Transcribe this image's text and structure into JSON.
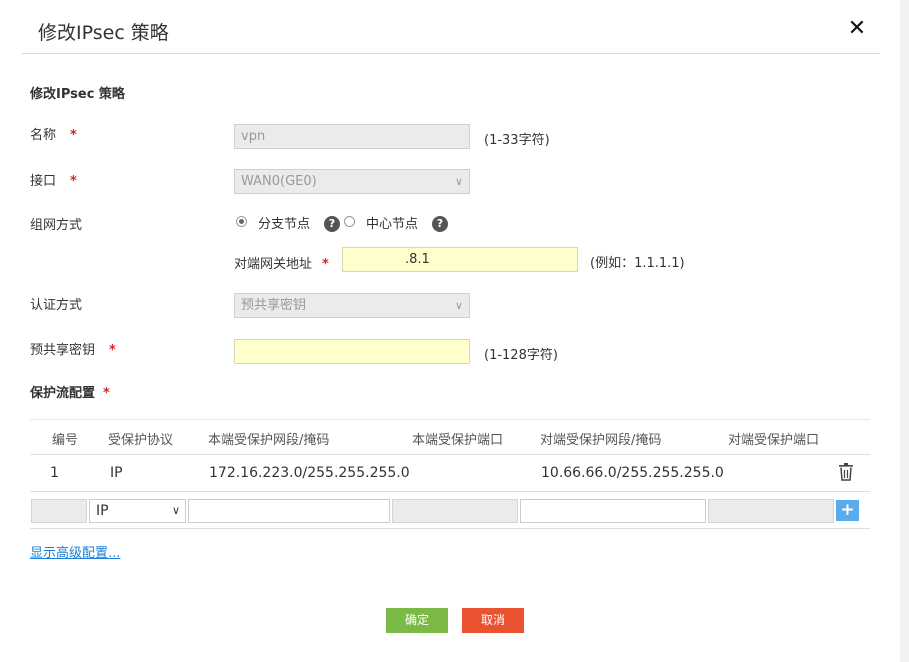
{
  "dialog": {
    "title": "修改IPsec 策略",
    "close_label": "✕"
  },
  "form": {
    "section_title": "修改IPsec 策略",
    "name": {
      "label": "名称",
      "required_mark": "*",
      "value": "vpn",
      "hint": "(1-33字符)"
    },
    "interface": {
      "label": "接口",
      "required_mark": "*",
      "value": "WAN0(GE0)"
    },
    "networking": {
      "label": "组网方式",
      "options": [
        {
          "label": "分支节点",
          "selected": true
        },
        {
          "label": "中心节点",
          "selected": false
        }
      ],
      "help_icon": "?"
    },
    "peer_gateway": {
      "label": "对端网关地址",
      "required_mark": "*",
      "value": ".8.1",
      "hint": "(例如：1.1.1.1)"
    },
    "auth_method": {
      "label": "认证方式",
      "value": "预共享密钥"
    },
    "psk": {
      "label": "预共享密钥",
      "required_mark": "*",
      "value": "",
      "hint": "(1-128字符)"
    },
    "protected_flow": {
      "label": "保护流配置",
      "required_mark": "*"
    }
  },
  "table": {
    "columns": [
      "编号",
      "受保护协议",
      "本端受保护网段/掩码",
      "本端受保护端口",
      "对端受保护网段/掩码",
      "对端受保护端口"
    ],
    "rows": [
      {
        "index": "1",
        "protocol": "IP",
        "local_net": "172.16.223.0/255.255.255.0",
        "local_port": "",
        "peer_net": "10.66.66.0/255.255.255.0",
        "peer_port": ""
      }
    ],
    "new_row": {
      "protocol": "IP",
      "add_label": "+"
    }
  },
  "advanced_link": "显示高级配置...",
  "buttons": {
    "ok": "确定",
    "cancel": "取消"
  },
  "colors": {
    "ok": "#7cba47",
    "cancel": "#e9532f",
    "input_highlight": "#ffffcc",
    "link": "#1a7fd8"
  }
}
